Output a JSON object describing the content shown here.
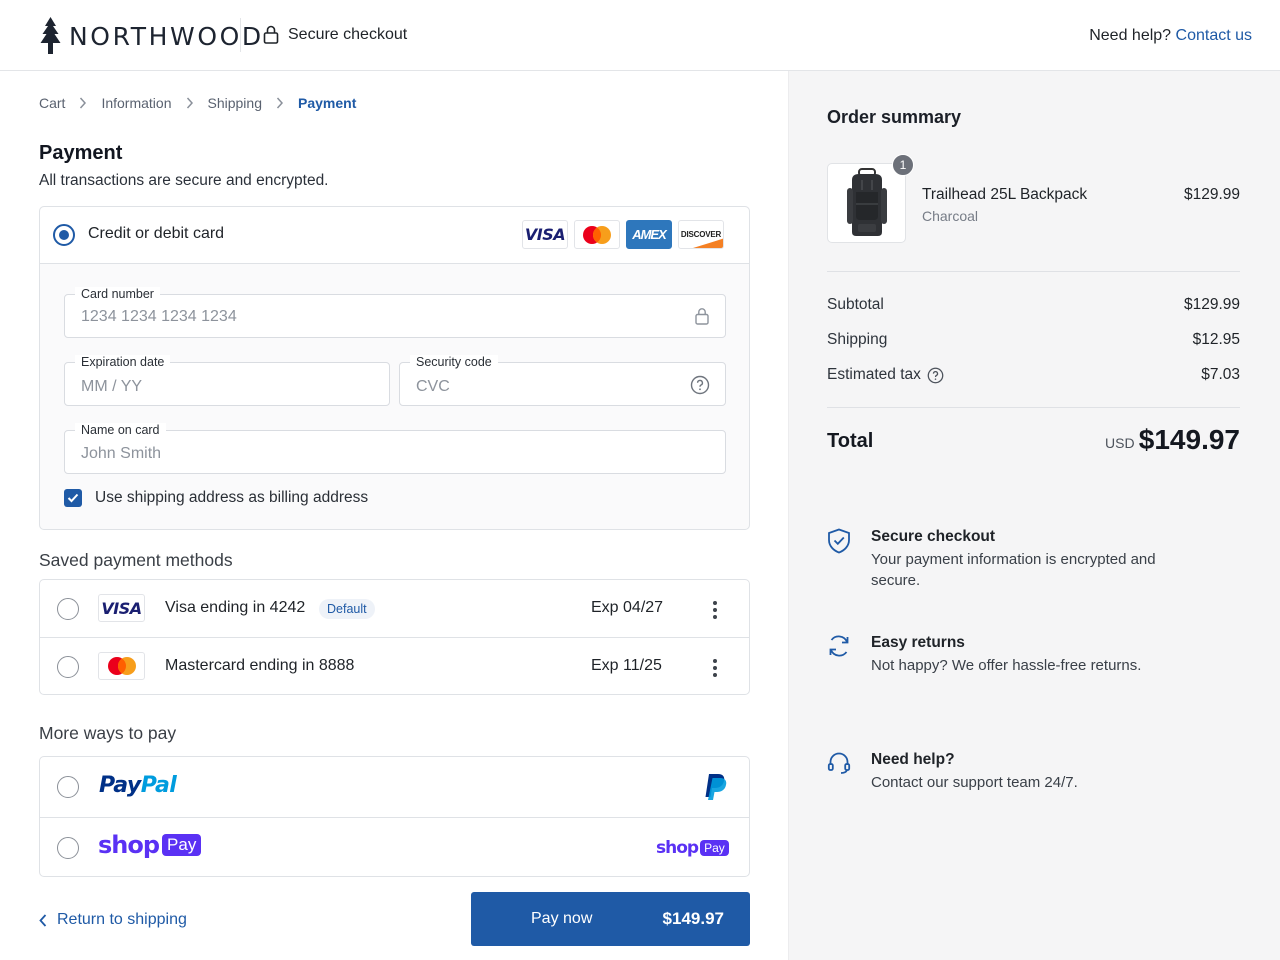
{
  "header": {
    "brand": "NORTHWOOD",
    "secure_label": "Secure checkout",
    "help_text": "Need help?",
    "contact_link": "Contact us"
  },
  "breadcrumb": [
    "Cart",
    "Information",
    "Shipping",
    "Payment"
  ],
  "payment": {
    "title": "Payment",
    "subtitle": "All transactions are secure and encrypted.",
    "card_option_label": "Credit or debit card",
    "card_brands": [
      "VISA",
      "Mastercard",
      "AMEX",
      "DISCOVER"
    ],
    "card_number": {
      "label": "Card number",
      "placeholder": "1234 1234 1234 1234"
    },
    "expiration": {
      "label": "Expiration date",
      "placeholder": "MM / YY"
    },
    "security": {
      "label": "Security code",
      "placeholder": "CVC"
    },
    "name": {
      "label": "Name on card",
      "placeholder": "John Smith"
    },
    "billing_same_label": "Use shipping address as billing address",
    "billing_same_checked": true
  },
  "saved": {
    "title": "Saved payment methods",
    "methods": [
      {
        "brand": "VISA",
        "label": "Visa ending in 4242",
        "badge": "Default",
        "exp": "Exp 04/27"
      },
      {
        "brand": "Mastercard",
        "label": "Mastercard ending in 8888",
        "badge": "",
        "exp": "Exp 11/25"
      }
    ]
  },
  "more": {
    "title": "More ways to pay",
    "paypal_pay": "Pay",
    "paypal_pal": "Pal",
    "shop_word": "shop",
    "shop_pill": "Pay"
  },
  "footer": {
    "back_label": "Return to shipping",
    "pay_label": "Pay now",
    "pay_amount": "$149.97"
  },
  "summary": {
    "title": "Order summary",
    "item": {
      "qty": "1",
      "name": "Trailhead 25L Backpack",
      "variant": "Charcoal",
      "price": "$129.99"
    },
    "subtotal_label": "Subtotal",
    "subtotal": "$129.99",
    "shipping_label": "Shipping",
    "shipping": "$12.95",
    "tax_label": "Estimated tax",
    "tax": "$7.03",
    "total_label": "Total",
    "currency": "USD",
    "total": "$149.97"
  },
  "features": [
    {
      "icon": "shield-check-icon",
      "title": "Secure checkout",
      "desc": "Your payment information is encrypted and secure."
    },
    {
      "icon": "refresh-icon",
      "title": "Easy returns",
      "desc": "Not happy? We offer hassle-free returns."
    },
    {
      "icon": "headset-icon",
      "title": "Need help?",
      "desc": "Contact our support team 24/7."
    }
  ],
  "colors": {
    "accent": "#1f5aa6",
    "shop_purple": "#5a31f4",
    "paypal_dark": "#003087",
    "paypal_light": "#009cde",
    "panel": "#f5f5f6"
  }
}
